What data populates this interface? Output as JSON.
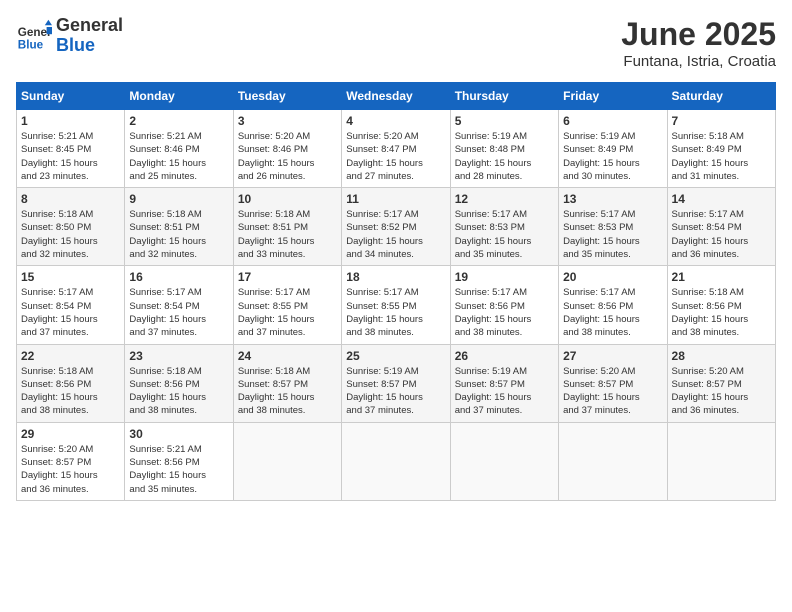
{
  "header": {
    "logo_general": "General",
    "logo_blue": "Blue",
    "title": "June 2025",
    "subtitle": "Funtana, Istria, Croatia"
  },
  "calendar": {
    "days_of_week": [
      "Sunday",
      "Monday",
      "Tuesday",
      "Wednesday",
      "Thursday",
      "Friday",
      "Saturday"
    ],
    "weeks": [
      [
        {
          "day": "1",
          "sunrise": "5:21 AM",
          "sunset": "8:45 PM",
          "daylight": "15 hours and 23 minutes."
        },
        {
          "day": "2",
          "sunrise": "5:21 AM",
          "sunset": "8:46 PM",
          "daylight": "15 hours and 25 minutes."
        },
        {
          "day": "3",
          "sunrise": "5:20 AM",
          "sunset": "8:46 PM",
          "daylight": "15 hours and 26 minutes."
        },
        {
          "day": "4",
          "sunrise": "5:20 AM",
          "sunset": "8:47 PM",
          "daylight": "15 hours and 27 minutes."
        },
        {
          "day": "5",
          "sunrise": "5:19 AM",
          "sunset": "8:48 PM",
          "daylight": "15 hours and 28 minutes."
        },
        {
          "day": "6",
          "sunrise": "5:19 AM",
          "sunset": "8:49 PM",
          "daylight": "15 hours and 30 minutes."
        },
        {
          "day": "7",
          "sunrise": "5:18 AM",
          "sunset": "8:49 PM",
          "daylight": "15 hours and 31 minutes."
        }
      ],
      [
        {
          "day": "8",
          "sunrise": "5:18 AM",
          "sunset": "8:50 PM",
          "daylight": "15 hours and 32 minutes."
        },
        {
          "day": "9",
          "sunrise": "5:18 AM",
          "sunset": "8:51 PM",
          "daylight": "15 hours and 32 minutes."
        },
        {
          "day": "10",
          "sunrise": "5:18 AM",
          "sunset": "8:51 PM",
          "daylight": "15 hours and 33 minutes."
        },
        {
          "day": "11",
          "sunrise": "5:17 AM",
          "sunset": "8:52 PM",
          "daylight": "15 hours and 34 minutes."
        },
        {
          "day": "12",
          "sunrise": "5:17 AM",
          "sunset": "8:53 PM",
          "daylight": "15 hours and 35 minutes."
        },
        {
          "day": "13",
          "sunrise": "5:17 AM",
          "sunset": "8:53 PM",
          "daylight": "15 hours and 35 minutes."
        },
        {
          "day": "14",
          "sunrise": "5:17 AM",
          "sunset": "8:54 PM",
          "daylight": "15 hours and 36 minutes."
        }
      ],
      [
        {
          "day": "15",
          "sunrise": "5:17 AM",
          "sunset": "8:54 PM",
          "daylight": "15 hours and 37 minutes."
        },
        {
          "day": "16",
          "sunrise": "5:17 AM",
          "sunset": "8:54 PM",
          "daylight": "15 hours and 37 minutes."
        },
        {
          "day": "17",
          "sunrise": "5:17 AM",
          "sunset": "8:55 PM",
          "daylight": "15 hours and 37 minutes."
        },
        {
          "day": "18",
          "sunrise": "5:17 AM",
          "sunset": "8:55 PM",
          "daylight": "15 hours and 38 minutes."
        },
        {
          "day": "19",
          "sunrise": "5:17 AM",
          "sunset": "8:56 PM",
          "daylight": "15 hours and 38 minutes."
        },
        {
          "day": "20",
          "sunrise": "5:17 AM",
          "sunset": "8:56 PM",
          "daylight": "15 hours and 38 minutes."
        },
        {
          "day": "21",
          "sunrise": "5:18 AM",
          "sunset": "8:56 PM",
          "daylight": "15 hours and 38 minutes."
        }
      ],
      [
        {
          "day": "22",
          "sunrise": "5:18 AM",
          "sunset": "8:56 PM",
          "daylight": "15 hours and 38 minutes."
        },
        {
          "day": "23",
          "sunrise": "5:18 AM",
          "sunset": "8:56 PM",
          "daylight": "15 hours and 38 minutes."
        },
        {
          "day": "24",
          "sunrise": "5:18 AM",
          "sunset": "8:57 PM",
          "daylight": "15 hours and 38 minutes."
        },
        {
          "day": "25",
          "sunrise": "5:19 AM",
          "sunset": "8:57 PM",
          "daylight": "15 hours and 37 minutes."
        },
        {
          "day": "26",
          "sunrise": "5:19 AM",
          "sunset": "8:57 PM",
          "daylight": "15 hours and 37 minutes."
        },
        {
          "day": "27",
          "sunrise": "5:20 AM",
          "sunset": "8:57 PM",
          "daylight": "15 hours and 37 minutes."
        },
        {
          "day": "28",
          "sunrise": "5:20 AM",
          "sunset": "8:57 PM",
          "daylight": "15 hours and 36 minutes."
        }
      ],
      [
        {
          "day": "29",
          "sunrise": "5:20 AM",
          "sunset": "8:57 PM",
          "daylight": "15 hours and 36 minutes."
        },
        {
          "day": "30",
          "sunrise": "5:21 AM",
          "sunset": "8:56 PM",
          "daylight": "15 hours and 35 minutes."
        },
        null,
        null,
        null,
        null,
        null
      ]
    ]
  }
}
